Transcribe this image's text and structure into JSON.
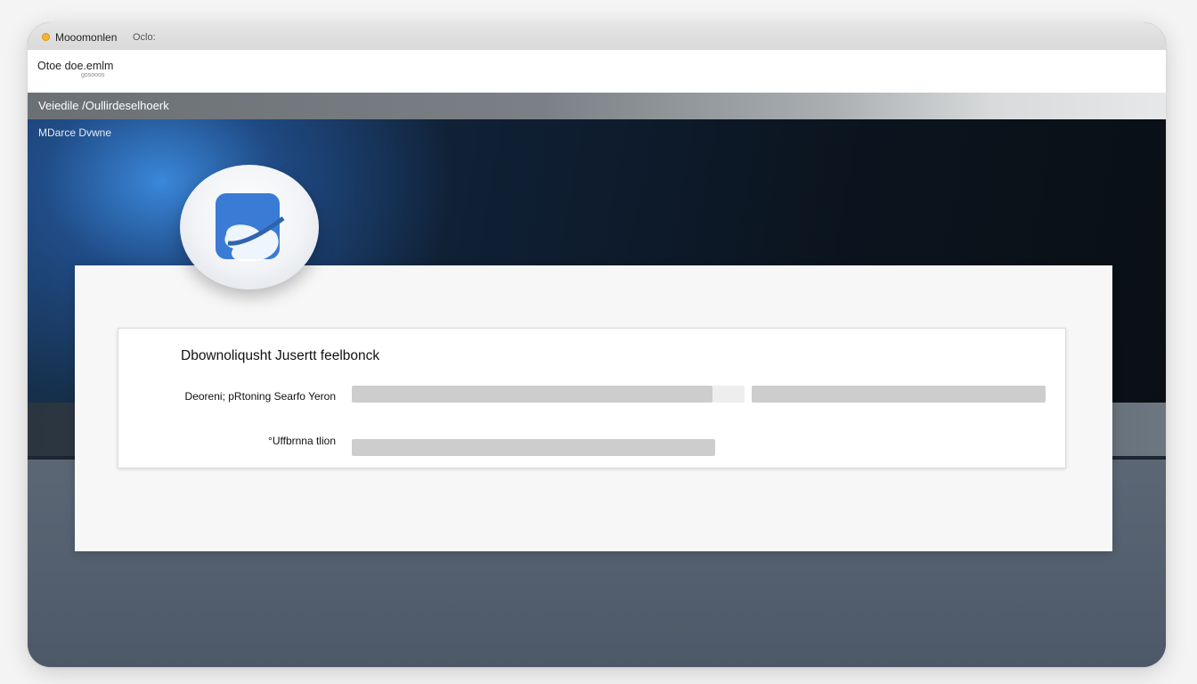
{
  "titlebar": {
    "app_name": "Mooomonlen",
    "menu_label": "Oclo:"
  },
  "address": {
    "title": "Otoe doe.emlm",
    "subtitle": "gosooos"
  },
  "toolbar": {
    "label": "Veiedile /Oullirdeselhoerk"
  },
  "hero": {
    "label": "MDarce Dvwne"
  },
  "logo": {
    "icon": "cloud-app-icon",
    "color": "#3a7bd5"
  },
  "dialog": {
    "title": "Dbownoliqusht Jusertt feelbonck",
    "fields": [
      {
        "label": "Deoreni; pRtoning Searfo Yeron",
        "value": ""
      },
      {
        "label": "°Uffbrnna tlion",
        "value": ""
      }
    ]
  },
  "colors": {
    "accent": "#3a7bd5",
    "titlebar_dot": "#f2b534",
    "field_fill": "#cdcdcd"
  }
}
